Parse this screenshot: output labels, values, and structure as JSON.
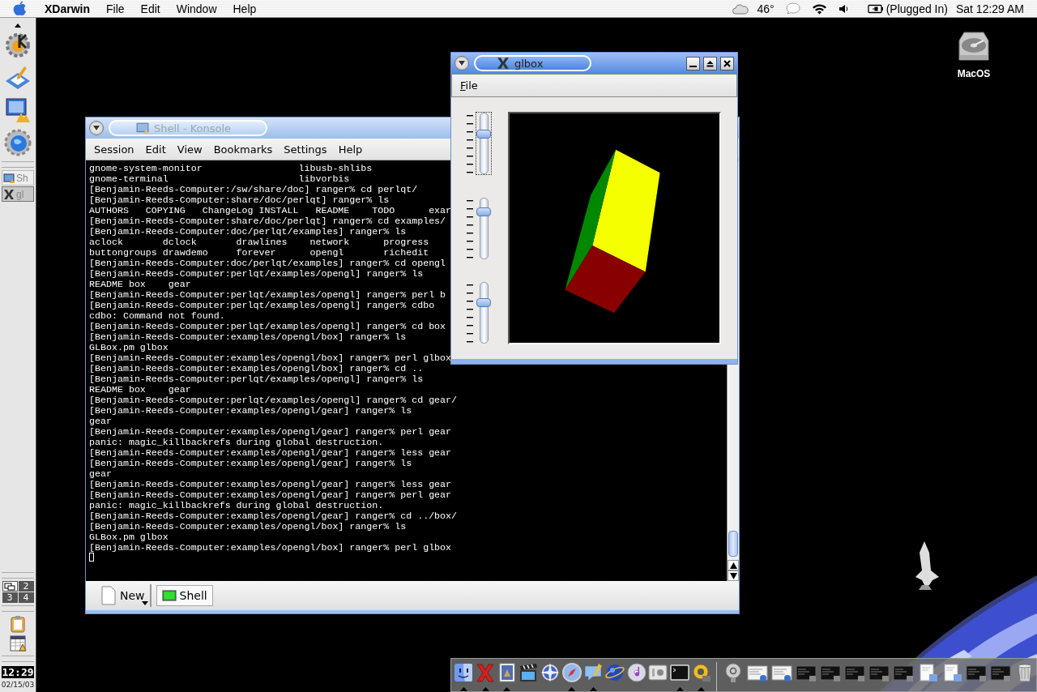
{
  "menubar": {
    "app_name": "XDarwin",
    "menus": [
      "File",
      "Edit",
      "Window",
      "Help"
    ],
    "temperature": "46°",
    "power_status": "(Plugged In)",
    "clock": "Sat 12:29 AM"
  },
  "panel": {
    "tasks": [
      {
        "kind": "konsole",
        "label": "Sh",
        "selected": false
      },
      {
        "kind": "x11",
        "label": "gl",
        "selected": true
      }
    ],
    "pager": [
      {
        "kind": "icon",
        "selected": true
      },
      {
        "kind": "number",
        "label": "2",
        "selected": false
      },
      {
        "kind": "number",
        "label": "3",
        "selected": false
      },
      {
        "kind": "number",
        "label": "4",
        "selected": false
      }
    ],
    "clock": "12:29",
    "date": "02/15/03"
  },
  "desktop_icons": [
    {
      "label": "MacOS"
    }
  ],
  "konsole": {
    "title": "Shell - Konsole",
    "active": false,
    "menus": [
      "Session",
      "Edit",
      "View",
      "Bookmarks",
      "Settings",
      "Help"
    ],
    "lines": [
      "gnome-system-monitor                 libusb-shlibs",
      "gnome-terminal                       libvorbis",
      "[Benjamin-Reeds-Computer:/sw/share/doc] ranger% cd perlqt/",
      "[Benjamin-Reeds-Computer:share/doc/perlqt] ranger% ls",
      "AUTHORS   COPYING   ChangeLog INSTALL   README    TODO      exar",
      "[Benjamin-Reeds-Computer:share/doc/perlqt] ranger% cd examples/",
      "[Benjamin-Reeds-Computer:doc/perlqt/examples] ranger% ls",
      "aclock       dclock       drawlines    network      progress",
      "buttongroups drawdemo     forever      opengl       richedit",
      "[Benjamin-Reeds-Computer:doc/perlqt/examples] ranger% cd opengl",
      "[Benjamin-Reeds-Computer:perlqt/examples/opengl] ranger% ls",
      "README box    gear",
      "[Benjamin-Reeds-Computer:perlqt/examples/opengl] ranger% perl b",
      "[Benjamin-Reeds-Computer:perlqt/examples/opengl] ranger% cdbo",
      "cdbo: Command not found.",
      "[Benjamin-Reeds-Computer:perlqt/examples/opengl] ranger% cd box",
      "[Benjamin-Reeds-Computer:examples/opengl/box] ranger% ls",
      "GLBox.pm glbox",
      "[Benjamin-Reeds-Computer:examples/opengl/box] ranger% perl glbox",
      "[Benjamin-Reeds-Computer:examples/opengl/box] ranger% cd ..",
      "[Benjamin-Reeds-Computer:perlqt/examples/opengl] ranger% ls",
      "README box    gear",
      "[Benjamin-Reeds-Computer:perlqt/examples/opengl] ranger% cd gear/",
      "[Benjamin-Reeds-Computer:examples/opengl/gear] ranger% ls",
      "gear",
      "[Benjamin-Reeds-Computer:examples/opengl/gear] ranger% perl gear",
      "panic: magic_killbackrefs during global destruction.",
      "[Benjamin-Reeds-Computer:examples/opengl/gear] ranger% less gear",
      "[Benjamin-Reeds-Computer:examples/opengl/gear] ranger% ls",
      "gear",
      "[Benjamin-Reeds-Computer:examples/opengl/gear] ranger% less gear",
      "[Benjamin-Reeds-Computer:examples/opengl/gear] ranger% perl gear",
      "panic: magic_killbackrefs during global destruction.",
      "[Benjamin-Reeds-Computer:examples/opengl/gear] ranger% cd ../box/",
      "[Benjamin-Reeds-Computer:examples/opengl/box] ranger% ls",
      "GLBox.pm glbox",
      "[Benjamin-Reeds-Computer:examples/opengl/box] ranger% perl glbox"
    ],
    "new_button": "New",
    "tabs": [
      {
        "label": "Shell",
        "selected": true
      }
    ]
  },
  "glbox": {
    "title": "glbox",
    "active": true,
    "menus": [
      "File"
    ],
    "sliders": [
      {
        "level": 0.67,
        "focused": true
      },
      {
        "level": 0.81,
        "focused": false
      },
      {
        "level": 0.69,
        "focused": false
      }
    ]
  },
  "dock": {
    "apps": [
      {
        "kind": "finder",
        "running": true
      },
      {
        "kind": "x11",
        "running": true
      },
      {
        "kind": "mail",
        "running": true
      },
      {
        "kind": "movie",
        "running": false
      },
      {
        "kind": "compass-globe",
        "running": false
      },
      {
        "kind": "compass",
        "running": true
      },
      {
        "kind": "chat",
        "running": true
      },
      {
        "kind": "globe",
        "running": false
      },
      {
        "kind": "disc",
        "running": false
      },
      {
        "kind": "prefs",
        "running": false
      },
      {
        "kind": "terminal",
        "running": true
      },
      {
        "kind": "gadget",
        "running": true
      }
    ],
    "docs": [
      {
        "kind": "at"
      },
      {
        "kind": "window-light"
      },
      {
        "kind": "window-light"
      },
      {
        "kind": "window-dark"
      },
      {
        "kind": "window-dark"
      },
      {
        "kind": "window-dark"
      },
      {
        "kind": "window-dark"
      },
      {
        "kind": "window-dark"
      },
      {
        "kind": "window-folder"
      },
      {
        "kind": "window-folder"
      },
      {
        "kind": "window-dark"
      },
      {
        "kind": "window-dark"
      },
      {
        "kind": "trash"
      }
    ]
  }
}
